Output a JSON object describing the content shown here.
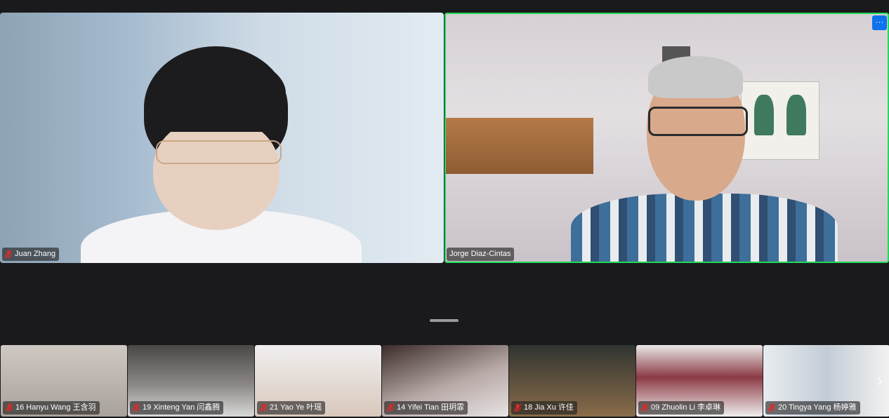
{
  "main_videos": [
    {
      "name": "Juan Zhang",
      "muted": true
    },
    {
      "name": "Jorge Diaz-Cintas",
      "muted": false,
      "active_speaker": true,
      "more_label": "···"
    }
  ],
  "thumbnails": [
    {
      "name": "16 Hanyu Wang 王含羽",
      "muted": true,
      "bg": "linear-gradient(180deg,#cfc8c2,#a9a29c)"
    },
    {
      "name": "19 Xinteng Yan 闫鑫腾",
      "muted": true,
      "bg": "linear-gradient(180deg,#4a4846,#8a8784 55%,#d9d9d9)"
    },
    {
      "name": "21 Yao Ye 叶瑶",
      "muted": true,
      "bg": "linear-gradient(180deg,#f0efef,#d9c8bc)"
    },
    {
      "name": "14 Yifei Tian 田玥霏",
      "muted": true,
      "bg": "linear-gradient(160deg,#3b2c2a,#b7a9a6 55%,#e8e3e4)"
    },
    {
      "name": "18 Jia Xu 许佳",
      "muted": true,
      "bg": "linear-gradient(180deg,#303430,#8a6c4a)"
    },
    {
      "name": "09 Zhuolin Li 李卓琳",
      "muted": true,
      "bg": "linear-gradient(180deg,#e9e8e8,#8c3a44 45%,#f0eeee)"
    },
    {
      "name": "20 Tingya Yang 杨婷雅",
      "muted": true,
      "bg": "linear-gradient(90deg,#e8ecf0,#c3ccd6 50%,#f2f2f2)"
    }
  ],
  "strip_next_label": "›",
  "colors": {
    "active_border": "#23d959",
    "mute_red": "#e02828",
    "more_button_blue": "#0e72ed"
  },
  "icons": {
    "mute": "microphone-muted-icon",
    "more": "more-options-icon",
    "next": "chevron-right-icon"
  }
}
